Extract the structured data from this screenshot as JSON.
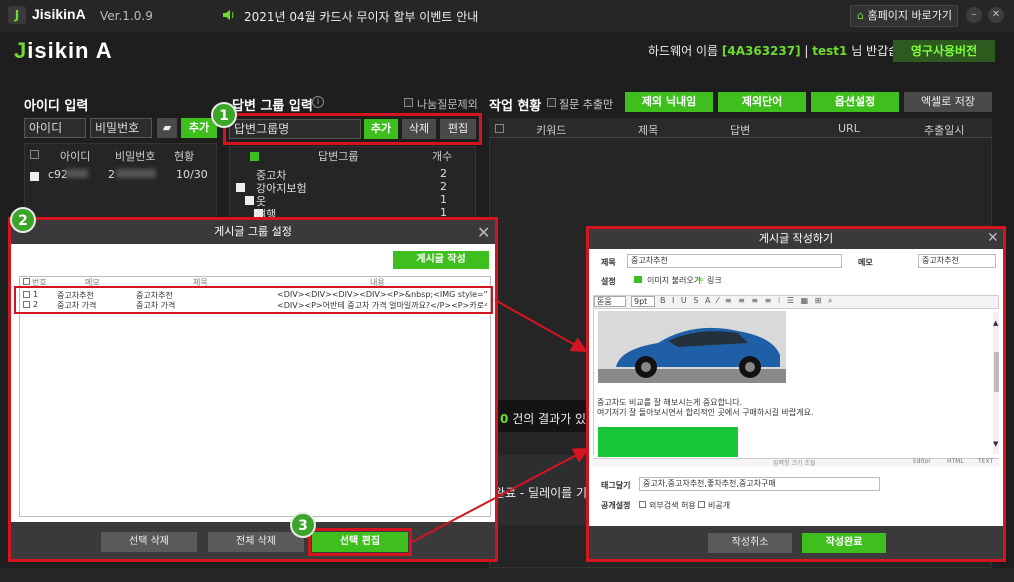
{
  "title_bar": {
    "app_name": "JisikinA",
    "version": "Ver.1.0.9",
    "notice": "2021년 04월 카드사 무이자 할부 이벤트 안내",
    "home_button": "홈페이지 바로가기"
  },
  "header": {
    "brand_j": "J",
    "brand_rest": "isikin A",
    "hw_label": "하드웨어 이름",
    "hw_id": "[4A363237]",
    "user": "test1",
    "greeting": "님 반갑습니다!",
    "license": "영구사용버전"
  },
  "id_panel": {
    "title": "아이디 입력",
    "id_value": "아이디",
    "pw_value": "비밀번호",
    "add": "추가",
    "columns": [
      "아이디",
      "비밀번호",
      "현황"
    ],
    "row": {
      "id": "c92",
      "pw": "2",
      "status": "10/30"
    }
  },
  "answer_panel": {
    "title": "답변 그룹 입력",
    "exclude_label": "나눔질문제외",
    "input_value": "답변그룹명",
    "add": "추가",
    "delete": "삭제",
    "edit": "편집",
    "columns": [
      "답변그룹",
      "개수"
    ],
    "rows": [
      {
        "name": "중고차",
        "count": "2"
      },
      {
        "name": "강아지보험",
        "count": "2"
      },
      {
        "name": "옷",
        "count": "1"
      },
      {
        "name": "여행",
        "count": "1"
      }
    ]
  },
  "work_panel": {
    "title": "작업 현황",
    "question_only": "질문 추출만",
    "buttons": [
      "제외 닉내임",
      "제외단어",
      "옵션설정"
    ],
    "excel": "엑셀로 저장",
    "columns": [
      "키워드",
      "제목",
      "답변",
      "URL",
      "추출일시"
    ],
    "result_num": "0",
    "result_text": "건의 결과가 있습",
    "delay_text": "완료 - 딜레이를 기다"
  },
  "group_dialog": {
    "title": "게시글 그룹 설정",
    "write_btn": "게시글 작성",
    "columns": [
      "번호",
      "메모",
      "제목",
      "내용"
    ],
    "rows": [
      {
        "no": "1",
        "memo": "중고차추천",
        "subject": "중고차추천",
        "content": "<DIV><DIV><DIV><DIV><P>&nbsp;<IMG style=\"HEIGHT:..."
      },
      {
        "no": "2",
        "memo": "중고차 가격",
        "subject": "중고차 가격",
        "content": "<DIV><P>어반테 중고차 가격 얼마일까요?</P><P>카로수..."
      }
    ],
    "delete_selected": "선택 삭제",
    "delete_all": "전체 삭제",
    "edit_selected": "선택 편집"
  },
  "write_dialog": {
    "title": "게시글 작성하기",
    "subject_label": "제목",
    "subject_value": "중고차추천",
    "memo_label": "메모",
    "memo_value": "중고차추천",
    "settings_label": "설정",
    "image_load": "이미지 불러오기",
    "link": "링크",
    "font_select": "돋움",
    "size_select": "9pt",
    "body_line1": "중고차도 비교를 잘 해보시는게 중요합니다.",
    "body_line2": "여기저기 잘 돌아보시면서 합리적인 곳에서 구매하시길 바랍게요.",
    "resize": "입력창 크기 조절",
    "tab_editor": "Editor",
    "tab_html": "HTML",
    "tab_text": "TEXT",
    "tag_label": "태그달기",
    "tag_value": "중고차,중고차추천,좋차추천,중고차구매",
    "public_label": "공개설정",
    "opt_external": "외부검색 허용",
    "opt_private": "비공개",
    "cancel": "작성취소",
    "done": "작성완료"
  },
  "badges": [
    "1",
    "2",
    "3"
  ],
  "colors": {
    "accent": "#3fbf1e",
    "highlight": "#d4151f"
  }
}
